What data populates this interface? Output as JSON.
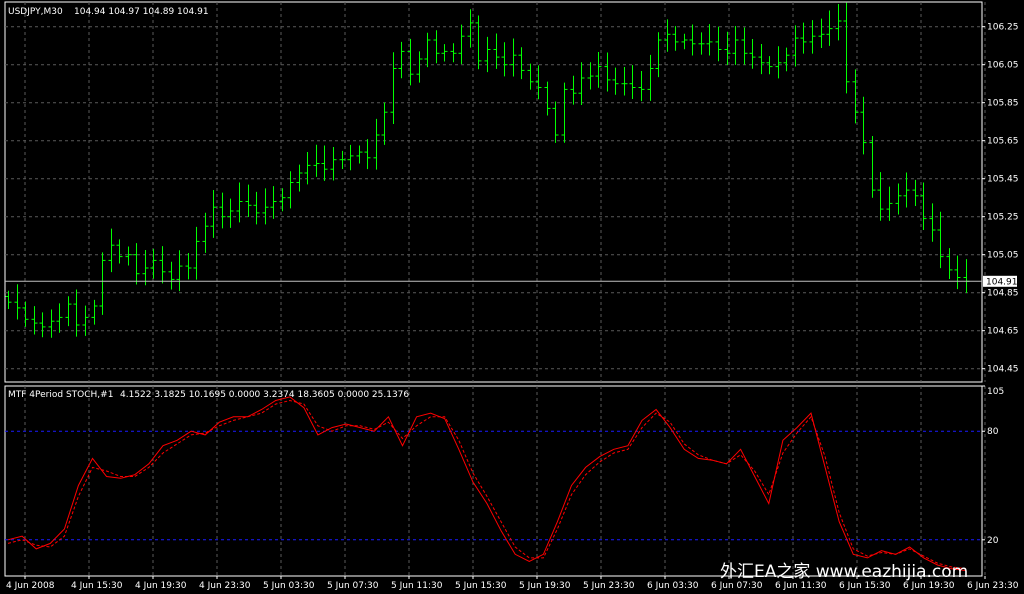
{
  "chart_data": [
    {
      "type": "ohlc",
      "title": "USDJPY,M30",
      "last_ohlc": "104.94 104.97 104.89 104.91",
      "current_price": "104.91",
      "ylim": [
        104.38,
        106.38
      ],
      "y_ticks": [
        "106.45",
        "106.25",
        "106.05",
        "105.85",
        "105.65",
        "105.45",
        "105.25",
        "105.05",
        "104.85",
        "104.65",
        "104.45"
      ],
      "x_ticks": [
        "4 Jun 2008",
        "4 Jun 15:30",
        "4 Jun 19:30",
        "4 Jun 23:30",
        "5 Jun 03:30",
        "5 Jun 07:30",
        "5 Jun 11:30",
        "5 Jun 15:30",
        "5 Jun 19:30",
        "5 Jun 23:30",
        "6 Jun 03:30",
        "6 Jun 07:30",
        "6 Jun 11:30",
        "6 Jun 15:30",
        "6 Jun 19:30",
        "6 Jun 23:30"
      ],
      "series": [
        {
          "color": "#00ff00",
          "close": [
            104.8,
            104.77,
            104.71,
            104.69,
            104.67,
            104.7,
            104.72,
            104.79,
            104.68,
            104.72,
            104.78,
            105.02,
            105.1,
            105.04,
            105.05,
            104.95,
            104.98,
            105.02,
            104.96,
            104.92,
            104.99,
            104.98,
            105.12,
            105.2,
            105.3,
            105.25,
            105.28,
            105.33,
            105.31,
            105.27,
            105.3,
            105.33,
            105.35,
            105.43,
            105.48,
            105.52,
            105.53,
            105.5,
            105.55,
            105.55,
            105.57,
            105.59,
            105.56,
            105.68,
            105.8,
            106.03,
            106.12,
            106.0,
            106.08,
            106.18,
            106.11,
            106.12,
            106.11,
            106.2,
            106.27,
            106.07,
            106.13,
            106.09,
            106.05,
            106.1,
            106.02,
            105.96,
            105.93,
            105.82,
            105.68,
            105.92,
            105.9,
            105.98,
            105.99,
            106.04,
            105.97,
            105.95,
            105.95,
            105.93,
            105.92,
            106.03,
            106.18,
            106.21,
            106.17,
            106.18,
            106.16,
            106.16,
            106.17,
            106.13,
            106.11,
            106.18,
            106.11,
            106.09,
            106.06,
            106.04,
            106.06,
            106.1,
            106.19,
            106.17,
            106.2,
            106.21,
            106.24,
            106.28,
            105.96,
            105.8,
            105.64,
            105.39,
            105.29,
            105.32,
            105.36,
            105.39,
            105.36,
            105.24,
            105.18,
            105.04,
            104.97,
            104.93,
            104.91
          ]
        }
      ]
    },
    {
      "type": "line",
      "title": "MTF 4Period STOCH,#1",
      "values_text": "4.1522 3.1825 10.1695 0.0000 3.2374 18.3605 0.0000 25.1376",
      "ylim": [
        0,
        105
      ],
      "y_ticks": [
        "105",
        "80",
        "20"
      ],
      "x_ticks": [
        "4 Jun 2008",
        "4 Jun 15:30",
        "4 Jun 19:30",
        "4 Jun 23:30",
        "5 Jun 03:30",
        "5 Jun 07:30",
        "5 Jun 11:30",
        "5 Jun 15:30",
        "5 Jun 19:30",
        "5 Jun 23:30",
        "6 Jun 03:30",
        "6 Jun 07:30",
        "6 Jun 11:30",
        "6 Jun 15:30",
        "6 Jun 19:30",
        "6 Jun 23:30"
      ],
      "levels": [
        80,
        20
      ],
      "series": [
        {
          "color": "#ff0000",
          "style": "solid",
          "values": [
            20,
            22,
            15,
            18,
            26,
            50,
            65,
            55,
            54,
            56,
            62,
            72,
            75,
            80,
            78,
            85,
            88,
            88,
            92,
            97,
            99,
            93,
            78,
            82,
            84,
            82,
            80,
            88,
            72,
            88,
            90,
            87,
            70,
            52,
            40,
            25,
            12,
            8,
            12,
            30,
            50,
            60,
            66,
            70,
            72,
            86,
            92,
            82,
            70,
            65,
            64,
            62,
            70,
            55,
            40,
            75,
            82,
            90,
            60,
            30,
            12,
            10,
            14,
            12,
            16,
            10,
            6,
            4,
            3
          ]
        },
        {
          "color": "#ff0000",
          "style": "dashed",
          "values": [
            18,
            20,
            17,
            16,
            22,
            44,
            60,
            58,
            55,
            55,
            60,
            68,
            73,
            78,
            79,
            83,
            86,
            88,
            90,
            95,
            97,
            95,
            83,
            80,
            83,
            83,
            81,
            85,
            76,
            83,
            88,
            88,
            75,
            57,
            44,
            30,
            16,
            10,
            10,
            26,
            45,
            56,
            63,
            68,
            70,
            82,
            90,
            85,
            73,
            67,
            64,
            62,
            67,
            58,
            45,
            68,
            79,
            88,
            66,
            35,
            15,
            11,
            13,
            12,
            15,
            11,
            7,
            5,
            4
          ]
        }
      ]
    }
  ],
  "watermark": "外汇EA之家 www.eazhijia.com"
}
